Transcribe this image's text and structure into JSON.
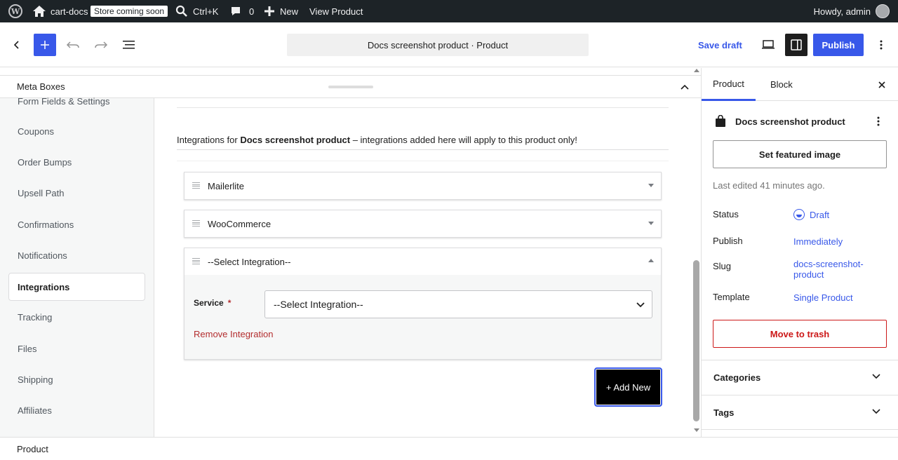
{
  "admin_bar": {
    "site_name": "cart-docs",
    "store_badge": "Store coming soon",
    "search_shortcut": "Ctrl+K",
    "comments_count": "0",
    "new_label": "New",
    "view_product": "View Product",
    "howdy": "Howdy, admin"
  },
  "header": {
    "document_title": "Docs screenshot product · Product",
    "save_draft": "Save draft",
    "publish": "Publish"
  },
  "metabox": {
    "title": "Meta Boxes"
  },
  "settings_nav": {
    "items": [
      {
        "label": "Form Fields & Settings"
      },
      {
        "label": "Coupons"
      },
      {
        "label": "Order Bumps"
      },
      {
        "label": "Upsell Path"
      },
      {
        "label": "Confirmations"
      },
      {
        "label": "Notifications"
      },
      {
        "label": "Integrations"
      },
      {
        "label": "Tracking"
      },
      {
        "label": "Files"
      },
      {
        "label": "Shipping"
      },
      {
        "label": "Affiliates"
      }
    ],
    "active": "Integrations"
  },
  "integrations": {
    "intro_prefix": "Integrations for ",
    "intro_product": "Docs screenshot product",
    "intro_suffix": " – integrations added here will apply to this product only!",
    "items": [
      {
        "name": "Mailerlite"
      },
      {
        "name": "WooCommerce"
      },
      {
        "name": "--Select Integration--"
      }
    ],
    "service_label": "Service",
    "required_mark": "*",
    "service_value": "--Select Integration--",
    "remove_label": "Remove Integration",
    "add_new_label": "+ Add New"
  },
  "sidebar": {
    "tabs": [
      {
        "label": "Product"
      },
      {
        "label": "Block"
      }
    ],
    "product_title": "Docs screenshot product",
    "featured_image": "Set featured image",
    "last_edited": "Last edited 41 minutes ago.",
    "rows": {
      "status_label": "Status",
      "status_value": "Draft",
      "publish_label": "Publish",
      "publish_value": "Immediately",
      "slug_label": "Slug",
      "slug_value": "docs-screenshot-product",
      "template_label": "Template",
      "template_value": "Single Product"
    },
    "trash": "Move to trash",
    "panels": [
      {
        "label": "Categories"
      },
      {
        "label": "Tags"
      }
    ]
  },
  "footer": {
    "breadcrumb": "Product"
  },
  "colors": {
    "accent": "#3858e9",
    "admin_bar": "#1d2327",
    "danger": "#cc1818",
    "remove_link": "#b32d2e"
  }
}
